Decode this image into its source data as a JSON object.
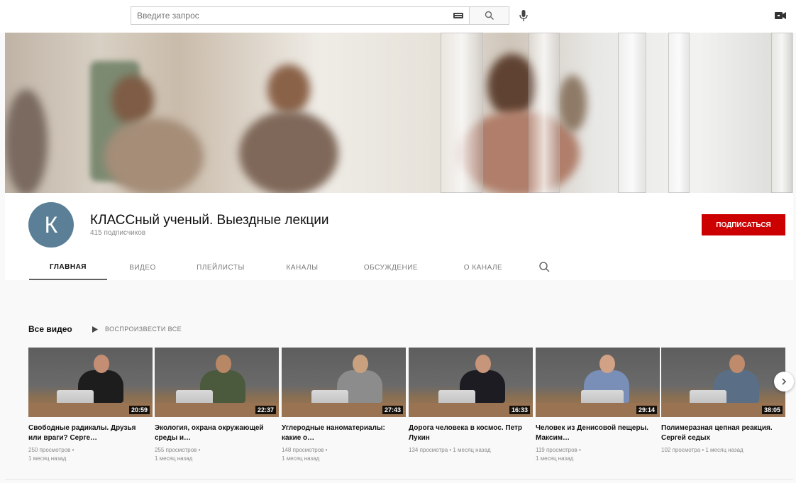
{
  "search": {
    "placeholder": "Введите запрос"
  },
  "channel": {
    "avatar_letter": "К",
    "avatar_color": "#5a7f97",
    "title": "КЛАССный ученый. Выездные лекции",
    "subscribers": "415 подписчиков",
    "subscribe_label": "ПОДПИСАТЬСЯ",
    "subscribe_color": "#cc0000"
  },
  "tabs": [
    {
      "label": "ГЛАВНАЯ",
      "active": true
    },
    {
      "label": "ВИДЕО",
      "active": false
    },
    {
      "label": "ПЛЕЙЛИСТЫ",
      "active": false
    },
    {
      "label": "КАНАЛЫ",
      "active": false
    },
    {
      "label": "ОБСУЖДЕНИЕ",
      "active": false
    },
    {
      "label": "О КАНАЛЕ",
      "active": false
    }
  ],
  "section": {
    "title": "Все видео",
    "play_all_label": "ВОСПРОИЗВЕСТИ ВСЕ"
  },
  "videos": [
    {
      "title": "Свободные радикалы. Друзья или враги? Серге…",
      "duration": "20:59",
      "views": "250 просмотров •",
      "age": "1 месяц назад"
    },
    {
      "title": "Экология, охрана окружающей среды и…",
      "duration": "22:37",
      "views": "255 просмотров •",
      "age": "1 месяц назад"
    },
    {
      "title": "Углеродные наноматериалы: какие о…",
      "duration": "27:43",
      "views": "148 просмотров •",
      "age": "1 месяц назад"
    },
    {
      "title": "Дорога человека в космос. Петр Лукин",
      "duration": "16:33",
      "views": "134 просмотра • 1 месяц назад",
      "age": ""
    },
    {
      "title": "Человек из Денисовой пещеры. Максим…",
      "duration": "29:14",
      "views": "119 просмотров •",
      "age": "1 месяц назад"
    },
    {
      "title": "Полимеразная цепная реакция. Сергей седых",
      "duration": "38:05",
      "views": "102 просмотра • 1 месяц назад",
      "age": ""
    }
  ]
}
